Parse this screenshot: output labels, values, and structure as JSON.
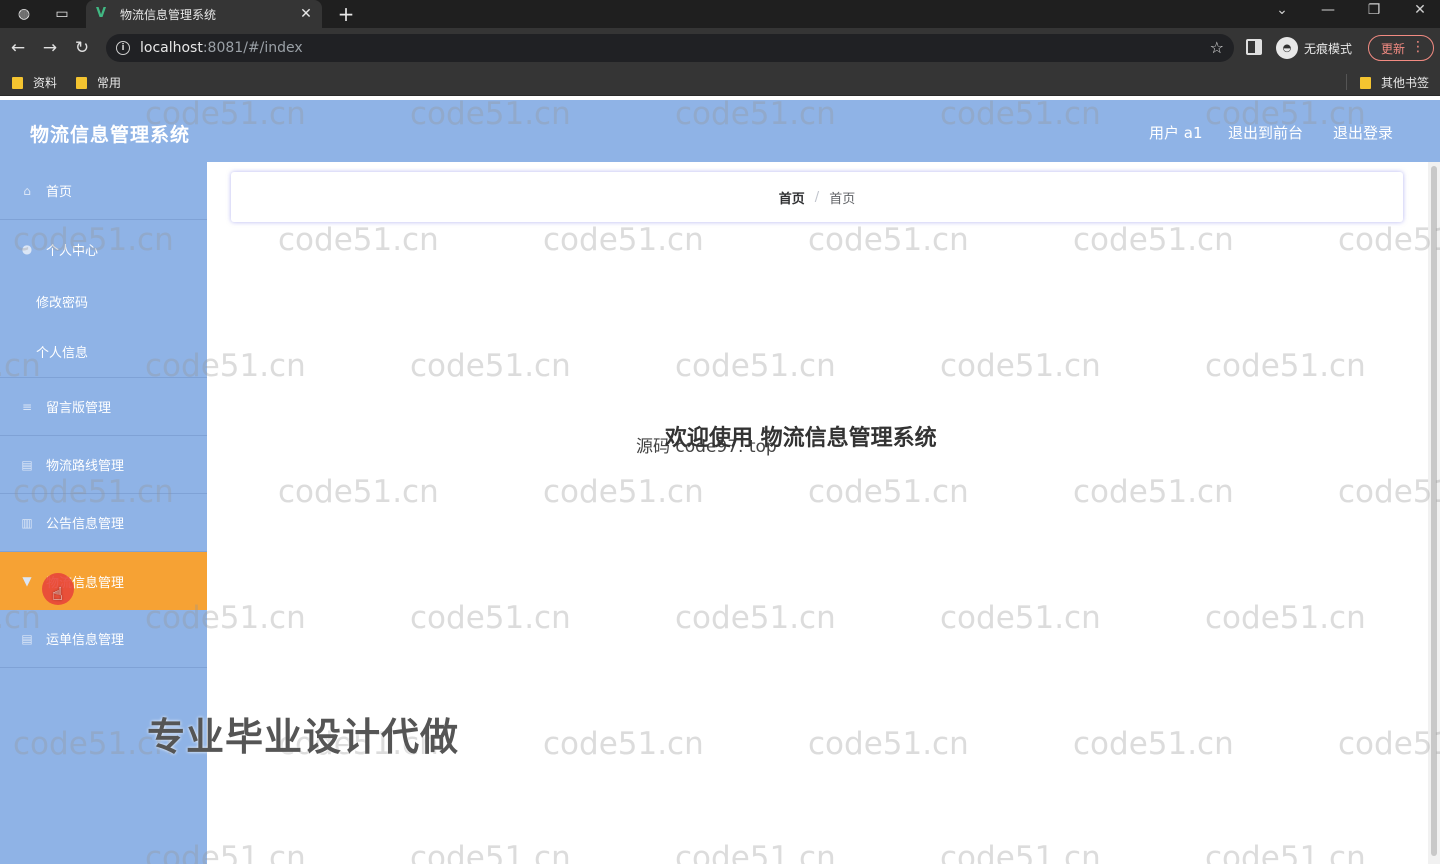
{
  "browser": {
    "tab_title": "物流信息管理系统",
    "url_host": "localhost",
    "url_rest": ":8081/#/index",
    "incognito_label": "无痕模式",
    "update_label": "更新",
    "bookmarks": [
      "资料",
      "常用"
    ],
    "other_bookmarks": "其他书签"
  },
  "header": {
    "title": "物流信息管理系统",
    "user_label": "用户 a1",
    "to_front": "退出到前台",
    "logout": "退出登录"
  },
  "sidebar": {
    "items": [
      {
        "label": "首页",
        "icon": "home-icon"
      },
      {
        "label": "个人中心",
        "icon": "user-icon"
      },
      {
        "label": "修改密码"
      },
      {
        "label": "个人信息"
      },
      {
        "label": "留言版管理",
        "icon": "list-icon"
      },
      {
        "label": "物流路线管理",
        "icon": "doc-icon"
      },
      {
        "label": "公告信息管理",
        "icon": "building-icon"
      },
      {
        "label": "物流信息管理",
        "icon": "pin-icon"
      },
      {
        "label": "运单信息管理",
        "icon": "doc-icon"
      }
    ]
  },
  "breadcrumb": {
    "first": "首页",
    "separator": "/",
    "second": "首页"
  },
  "main": {
    "welcome": "欢迎使用 物流信息管理系统"
  },
  "overlays": {
    "source_text": "源码 code97. top",
    "promo": "专业毕业设计代做",
    "watermark": "code51.cn"
  },
  "colors": {
    "theme": "#8fb3e6",
    "active": "#f6a234",
    "tab_bar": "#1f1f1f"
  }
}
